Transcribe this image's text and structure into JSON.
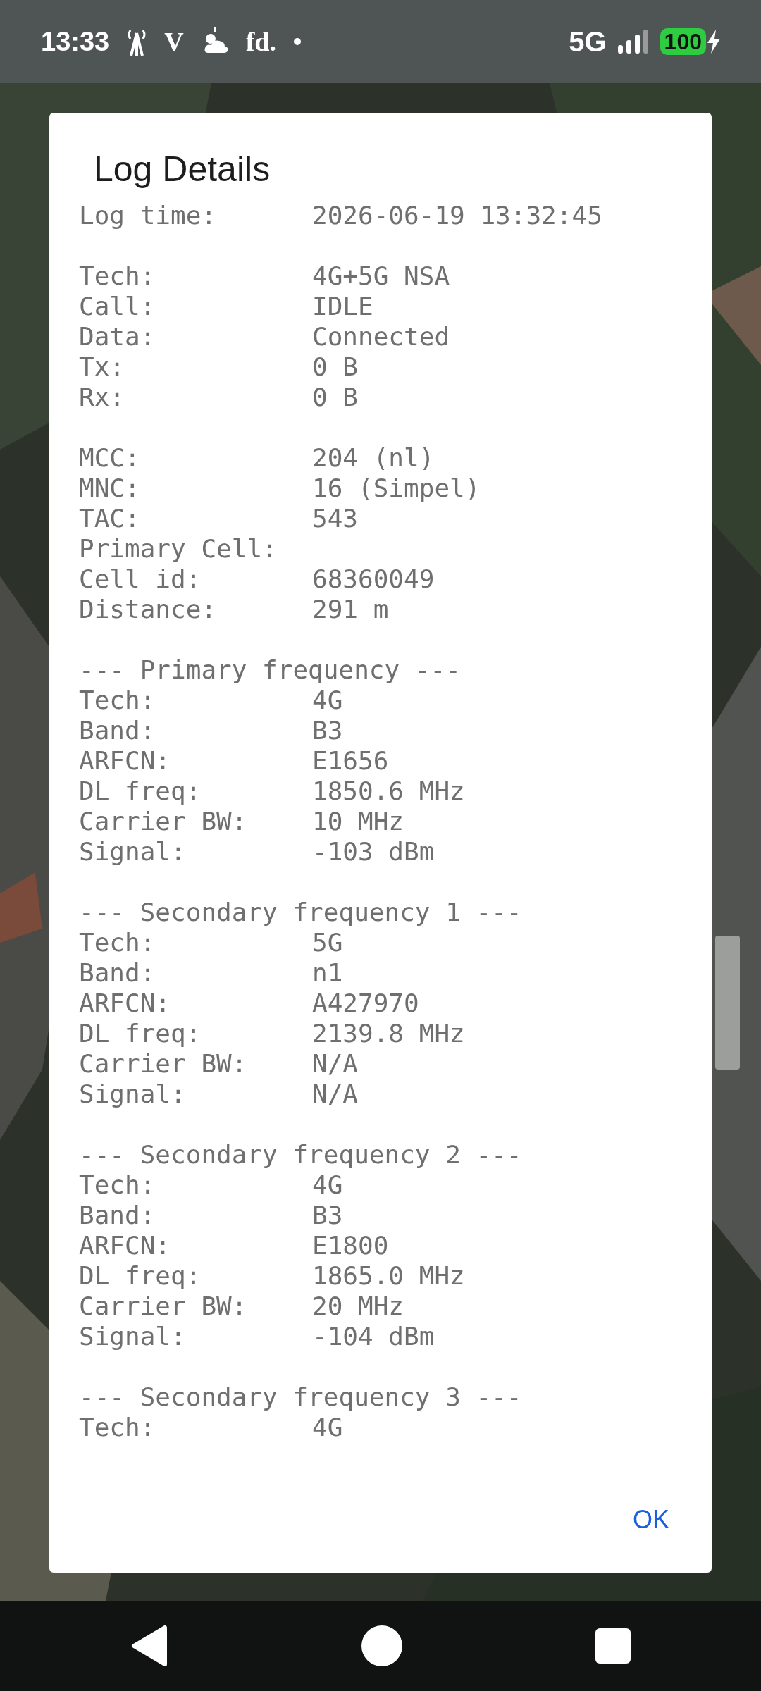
{
  "status_bar": {
    "time": "13:33",
    "notifications": [
      {
        "kind": "antenna"
      },
      {
        "kind": "text",
        "text": "V"
      },
      {
        "kind": "weather"
      },
      {
        "kind": "text",
        "text": "fd."
      },
      {
        "kind": "dot"
      }
    ],
    "network": "5G",
    "battery": "100",
    "charging": true
  },
  "dialog": {
    "title": "Log Details",
    "sections": [
      {
        "rows": [
          {
            "label": "Log time:",
            "value": "2026-06-19 13:32:45"
          }
        ]
      },
      {
        "rows": [
          {
            "label": "Tech:",
            "value": "4G+5G NSA"
          },
          {
            "label": "Call:",
            "value": "IDLE"
          },
          {
            "label": "Data:",
            "value": "Connected"
          },
          {
            "label": "Tx:",
            "value": "0 B"
          },
          {
            "label": "Rx:",
            "value": "0 B"
          }
        ]
      },
      {
        "rows": [
          {
            "label": "MCC:",
            "value": "204 (nl)"
          },
          {
            "label": "MNC:",
            "value": "16 (Simpel)"
          },
          {
            "label": "TAC:",
            "value": "543"
          },
          {
            "label": "Primary Cell:"
          },
          {
            "label": "Cell id:",
            "value": "68360049"
          },
          {
            "label": "Distance:",
            "value": "291 m"
          }
        ]
      },
      {
        "heading": "--- Primary frequency ---",
        "rows": [
          {
            "label": "Tech:",
            "value": "4G"
          },
          {
            "label": "Band:",
            "value": "B3"
          },
          {
            "label": "ARFCN:",
            "value": "E1656"
          },
          {
            "label": "DL freq:",
            "value": "1850.6 MHz"
          },
          {
            "label": "Carrier BW:",
            "value": "10 MHz"
          },
          {
            "label": "Signal:",
            "value": "-103 dBm"
          }
        ]
      },
      {
        "heading": "--- Secondary frequency 1 ---",
        "rows": [
          {
            "label": "Tech:",
            "value": "5G"
          },
          {
            "label": "Band:",
            "value": "n1"
          },
          {
            "label": "ARFCN:",
            "value": "A427970"
          },
          {
            "label": "DL freq:",
            "value": "2139.8 MHz"
          },
          {
            "label": "Carrier BW:",
            "value": "N/A"
          },
          {
            "label": "Signal:",
            "value": "N/A"
          }
        ]
      },
      {
        "heading": "--- Secondary frequency 2 ---",
        "rows": [
          {
            "label": "Tech:",
            "value": "4G"
          },
          {
            "label": "Band:",
            "value": "B3"
          },
          {
            "label": "ARFCN:",
            "value": "E1800"
          },
          {
            "label": "DL freq:",
            "value": "1865.0 MHz"
          },
          {
            "label": "Carrier BW:",
            "value": "20 MHz"
          },
          {
            "label": "Signal:",
            "value": "-104 dBm"
          }
        ]
      },
      {
        "heading": "--- Secondary frequency 3 ---",
        "rows": [
          {
            "label": "Tech:",
            "value": "4G"
          }
        ]
      }
    ],
    "button": "OK"
  }
}
